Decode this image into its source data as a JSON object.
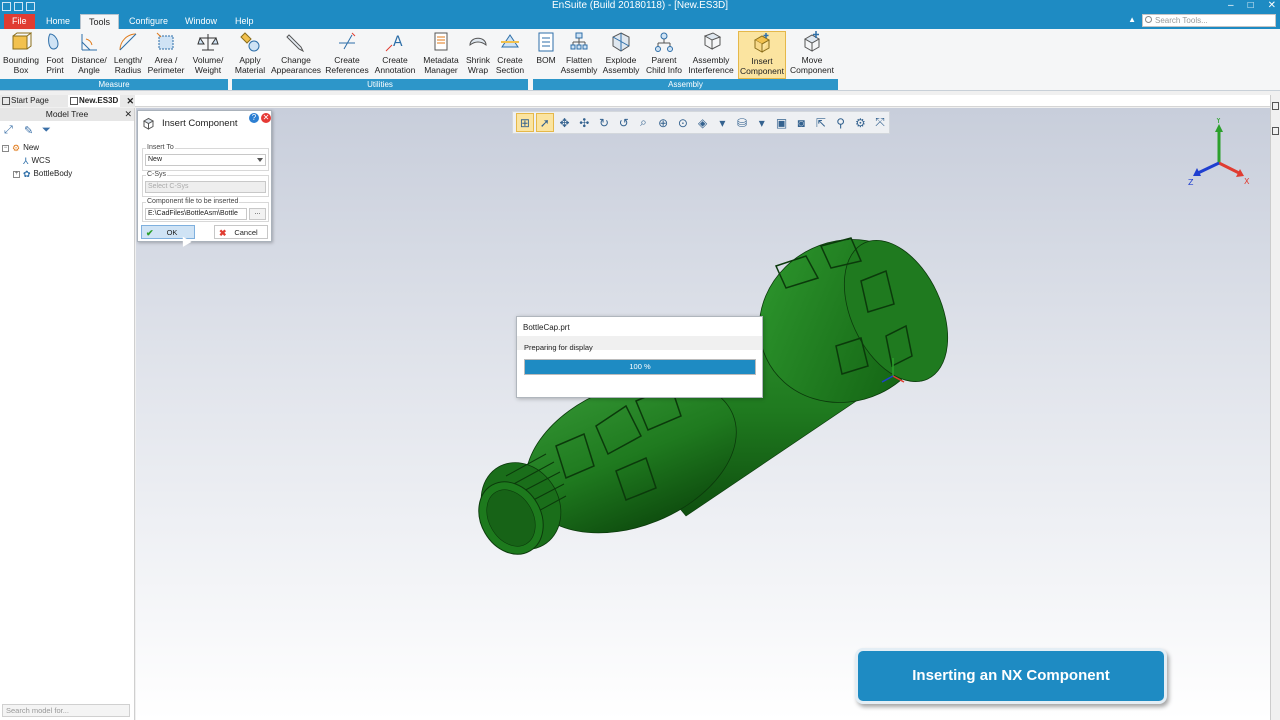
{
  "window": {
    "title": "EnSuite (Build 20180118) - [New.ES3D]",
    "controls": [
      "–",
      "□",
      "✕"
    ]
  },
  "ribbon_tabs": {
    "file": "File",
    "home": "Home",
    "tools": "Tools",
    "configure": "Configure",
    "window": "Window",
    "help": "Help",
    "search_placeholder": "Search Tools..."
  },
  "ribbon": {
    "measure": {
      "label": "Measure",
      "bounding_box": [
        "Bounding",
        "Box"
      ],
      "foot_print": [
        "Foot",
        "Print"
      ],
      "distance_angle": [
        "Distance/",
        "Angle"
      ],
      "length_radius": [
        "Length/",
        "Radius"
      ],
      "area_perimeter": [
        "Area /",
        "Perimeter"
      ],
      "volume_weight": [
        "Volume/",
        "Weight"
      ]
    },
    "utilities": {
      "label": "Utilities",
      "apply_material": [
        "Apply",
        "Material"
      ],
      "change_appearances": [
        "Change",
        "Appearances"
      ],
      "create_references": [
        "Create",
        "References"
      ],
      "create_annotation": [
        "Create",
        "Annotation"
      ],
      "metadata_manager": [
        "Metadata",
        "Manager"
      ],
      "shrink_wrap": [
        "Shrink",
        "Wrap"
      ],
      "create_section": [
        "Create",
        "Section"
      ]
    },
    "assembly": {
      "label": "Assembly",
      "bom": [
        "BOM",
        ""
      ],
      "flatten_assembly": [
        "Flatten",
        "Assembly"
      ],
      "explode_assembly": [
        "Explode",
        "Assembly"
      ],
      "parent_child_info": [
        "Parent",
        "Child Info"
      ],
      "assembly_interference": [
        "Assembly",
        "Interference"
      ],
      "insert_component": [
        "Insert",
        "Component"
      ],
      "move_component": [
        "Move",
        "Component"
      ]
    }
  },
  "doc_tabs": {
    "start_page": "Start Page",
    "active": "New.ES3D"
  },
  "model_tree": {
    "title": "Model Tree",
    "root": "New",
    "children": [
      "WCS",
      "BottleBody"
    ],
    "search_placeholder": "Search model for..."
  },
  "insert_dialog": {
    "title": "Insert Component",
    "insert_to_label": "Insert To",
    "insert_to_value": "New",
    "csys_label": "C-Sys",
    "csys_placeholder": "Select C-Sys",
    "file_label": "Component file to be inserted",
    "file_value": "E:\\CadFiles\\BottleAsm\\Bottle",
    "browse": "...",
    "ok": "OK",
    "cancel": "Cancel"
  },
  "progress_dialog": {
    "title": "BottleCap.prt",
    "message": "Preparing for display",
    "percent": 100,
    "percent_text": "100 %"
  },
  "triad": {
    "x": "X",
    "y": "Y",
    "z": "Z"
  },
  "caption": "Inserting an NX Component",
  "colors": {
    "accent": "#1e8bc3",
    "file_tab": "#e03c31",
    "model_green": "#1f7a1f",
    "highlight": "#fbe4a0"
  }
}
